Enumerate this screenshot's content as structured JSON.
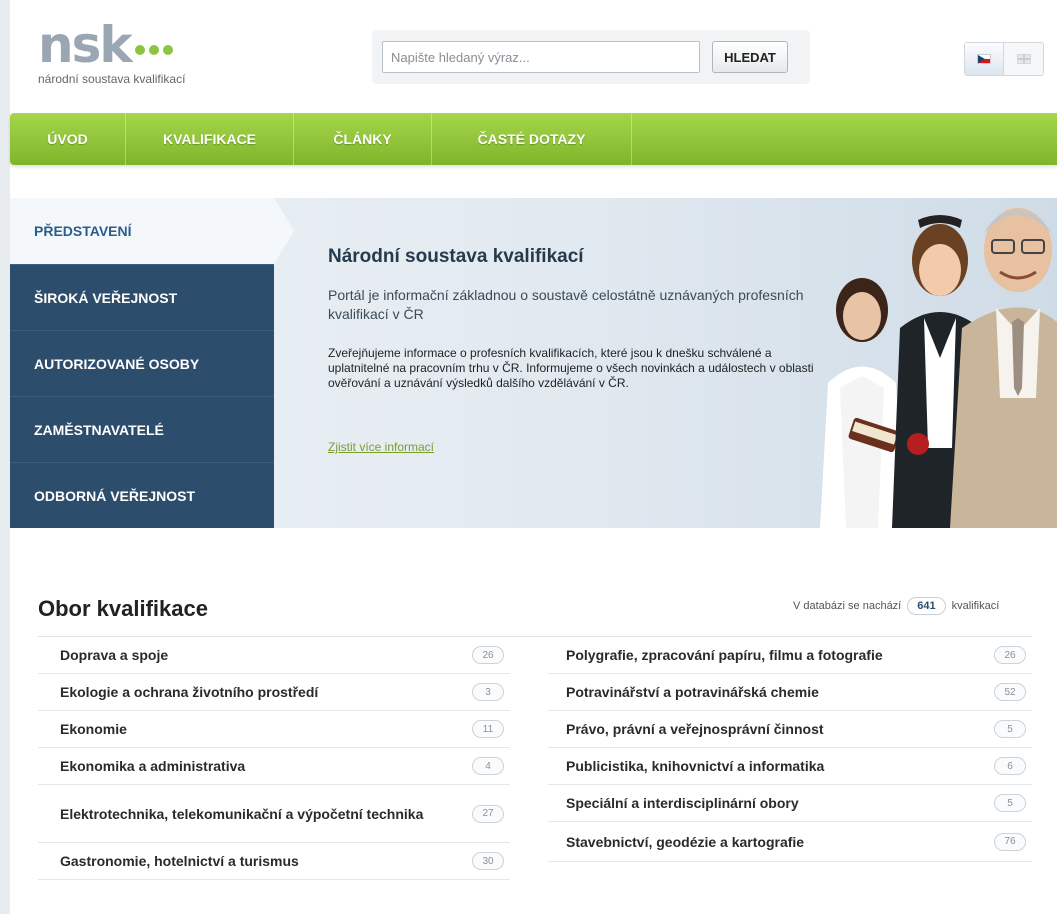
{
  "header": {
    "logo_text": "nsk",
    "logo_subtitle": "národní soustava kvalifikací",
    "search_placeholder": "Napište hledaný výraz...",
    "search_button": "HLEDAT"
  },
  "nav": {
    "items": [
      "ÚVOD",
      "KVALIFIKACE",
      "ČLÁNKY",
      "ČASTÉ DOTAZY"
    ]
  },
  "sidebar": {
    "items": [
      "PŘEDSTAVENÍ",
      "ŠIROKÁ VEŘEJNOST",
      "AUTORIZOVANÉ OSOBY",
      "ZAMĚSTNAVATELÉ",
      "ODBORNÁ VEŘEJNOST"
    ]
  },
  "hero": {
    "title": "Národní soustava kvalifikací",
    "lead": "Portál je informační základnou o soustavě celostátně uznávaných profesních kvalifikací v ČR",
    "text": "Zveřejňujeme informace o profesních kvalifikacích, které jsou k dnešku schválené a uplatnitelné na pracovním trhu v ČR. Informujeme o všech novinkách a událostech v oblasti ověřování a uznávání výsledků dalšího vzdělávání v ČR.",
    "link": "Zjistit více informací"
  },
  "obor": {
    "title": "Obor kvalifikace",
    "db_prefix": "V databázi se nachází",
    "db_count": "641",
    "db_suffix": "kvalifikací",
    "left": [
      {
        "label": "Doprava a spoje",
        "count": "26"
      },
      {
        "label": "Ekologie a ochrana životního prostředí",
        "count": "3"
      },
      {
        "label": "Ekonomie",
        "count": "11"
      },
      {
        "label": "Ekonomika a administrativa",
        "count": "4"
      },
      {
        "label": "Elektrotechnika, telekomunikační a výpočetní technika",
        "count": "27"
      },
      {
        "label": "Gastronomie, hotelnictví a turismus",
        "count": "30"
      }
    ],
    "right": [
      {
        "label": "Polygrafie, zpracování papíru, filmu a fotografie",
        "count": "26"
      },
      {
        "label": "Potravinářství a potravinářská chemie",
        "count": "52"
      },
      {
        "label": "Právo, právní a veřejnosprávní činnost",
        "count": "5"
      },
      {
        "label": "Publicistika, knihovnictví a informatika",
        "count": "6"
      },
      {
        "label": "Speciální a interdisciplinární obory",
        "count": "5"
      },
      {
        "label": "Stavebnictví, geodézie a kartografie",
        "count": "76"
      }
    ]
  }
}
